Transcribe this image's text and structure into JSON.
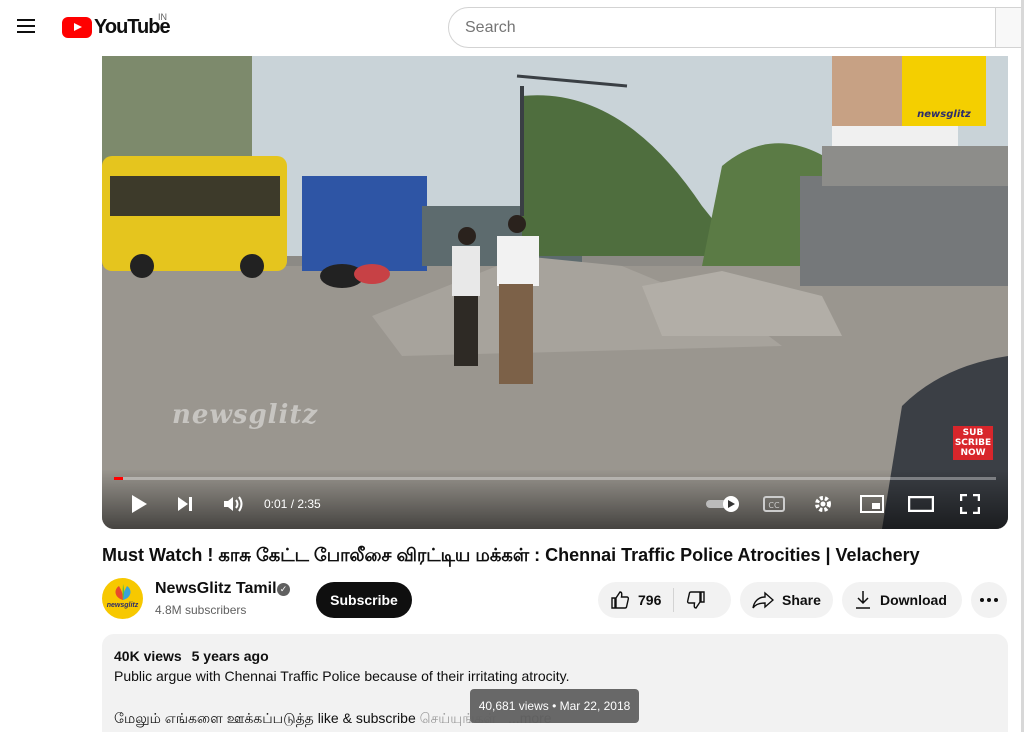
{
  "header": {
    "logo_text": "YouTube",
    "country_code": "IN",
    "search_placeholder": "Search"
  },
  "player": {
    "current_time": "0:01",
    "duration": "2:35",
    "time_display": "0:01 / 2:35",
    "progress_fraction": 0.006,
    "watermark": "newsglitz",
    "brand_sign_text": "newsglitz",
    "subscribe_badge": [
      "SUB",
      "SCRIBE",
      "NOW"
    ]
  },
  "video": {
    "title": "Must Watch ! காசு கேட்ட போலீசை விரட்டிய மக்கள் : Chennai Traffic Police Atrocities | Velachery"
  },
  "channel": {
    "name": "NewsGlitz Tamil",
    "subscribers": "4.8M subscribers",
    "subscribe_label": "Subscribe",
    "avatar_text": "newsglitz"
  },
  "actions": {
    "like_count": "796",
    "share_label": "Share",
    "download_label": "Download"
  },
  "description": {
    "views": "40K views",
    "age": "5 years ago",
    "line1": "Public argue with Chennai Traffic Police because of their irritating atrocity.",
    "line2": "மேலும் எங்களை ஊக்கப்படுத்த like & subscribe",
    "line2_hidden": "செய்யுங்கள்",
    "more_label": "...more"
  },
  "tooltip": {
    "text": "40,681 views • Mar 22, 2018"
  },
  "colors": {
    "brand_red": "#ff0000",
    "progress_red": "#ff0000",
    "subscribe_bg": "#0f0f0f",
    "pill_bg": "#f2f2f2"
  }
}
